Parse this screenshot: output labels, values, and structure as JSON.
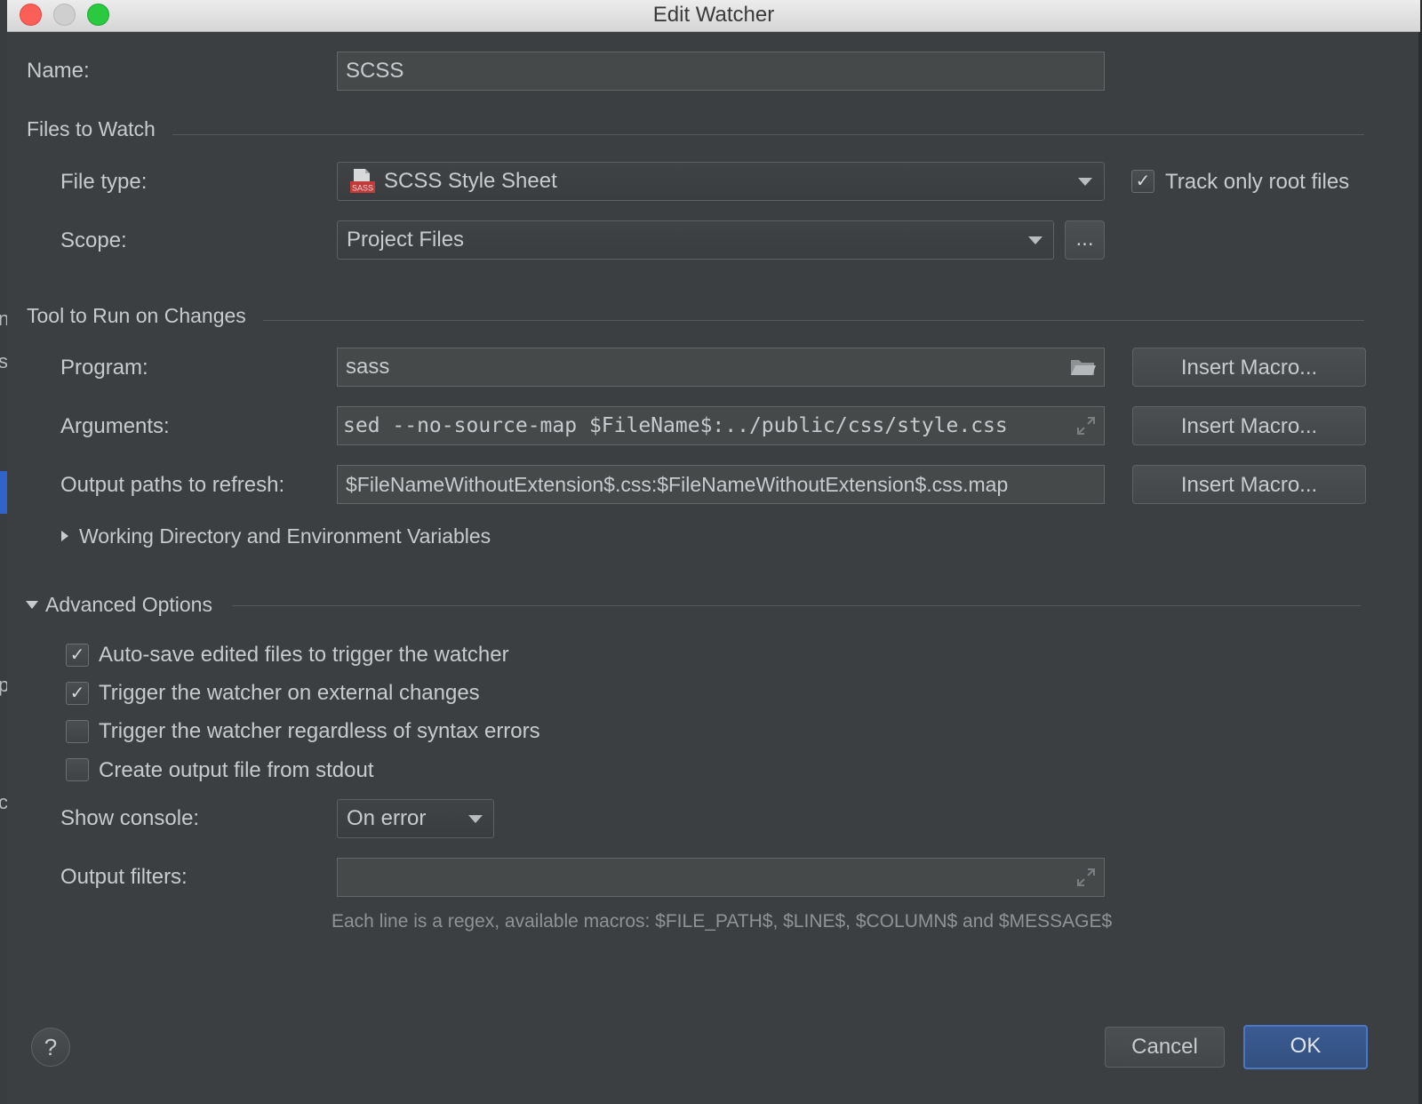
{
  "window": {
    "title": "Edit Watcher"
  },
  "name": {
    "label": "Name:",
    "value": "SCSS"
  },
  "files_to_watch": {
    "section_title": "Files to Watch",
    "file_type": {
      "label": "File type:",
      "value": "SCSS Style Sheet",
      "icon": "sass-file-icon",
      "icon_text": "SASS"
    },
    "track_root": {
      "label": "Track only root files",
      "checked": true
    },
    "scope": {
      "label": "Scope:",
      "value": "Project Files",
      "browse_label": "..."
    }
  },
  "tool": {
    "section_title": "Tool to Run on Changes",
    "program": {
      "label": "Program:",
      "value": "sass",
      "icon": "folder-icon"
    },
    "arguments": {
      "label": "Arguments:",
      "value": "sed --no-source-map $FileName$:../public/css/style.css"
    },
    "output_paths": {
      "label": "Output paths to refresh:",
      "value": "$FileNameWithoutExtension$.css:$FileNameWithoutExtension$.css.map"
    },
    "insert_macro_label": "Insert Macro...",
    "working_dir": {
      "label": "Working Directory and Environment Variables",
      "expanded": false
    }
  },
  "advanced": {
    "section_title": "Advanced Options",
    "expanded": true,
    "options": [
      {
        "label": "Auto-save edited files to trigger the watcher",
        "checked": true
      },
      {
        "label": "Trigger the watcher on external changes",
        "checked": true
      },
      {
        "label": "Trigger the watcher regardless of syntax errors",
        "checked": false
      },
      {
        "label": "Create output file from stdout",
        "checked": false
      }
    ],
    "show_console": {
      "label": "Show console:",
      "value": "On error"
    },
    "output_filters": {
      "label": "Output filters:",
      "value": "",
      "hint": "Each line is a regex, available macros: $FILE_PATH$, $LINE$, $COLUMN$ and $MESSAGE$"
    }
  },
  "footer": {
    "help_label": "?",
    "cancel_label": "Cancel",
    "ok_label": "OK"
  },
  "background": {
    "fragments": [
      "n",
      "s",
      "p",
      "c"
    ]
  },
  "colors": {
    "dialog_bg": "#3c3f41",
    "field_bg": "#45494a",
    "accent": "#4a78c2",
    "text": "#c8cbce"
  }
}
